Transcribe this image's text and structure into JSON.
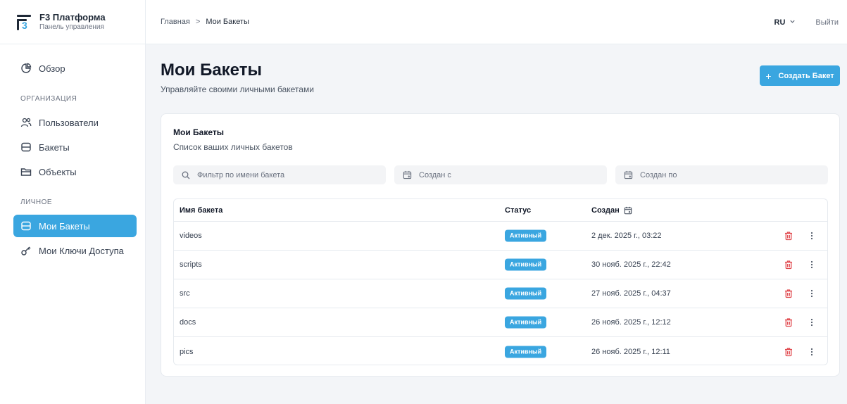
{
  "brand": {
    "title": "F3 Платформа",
    "subtitle": "Панель управления",
    "logo_digit": "3"
  },
  "sidebar": {
    "overview": "Обзор",
    "section_org": "ОРГАНИЗАЦИЯ",
    "users": "Пользователи",
    "buckets": "Бакеты",
    "objects": "Объекты",
    "section_personal": "ЛИЧНОЕ",
    "my_buckets": "Мои Бакеты",
    "my_keys": "Мои Ключи Доступа"
  },
  "topbar": {
    "breadcrumb_home": "Главная",
    "breadcrumb_sep": ">",
    "breadcrumb_current": "Мои Бакеты",
    "lang": "RU",
    "logout": "Выйти"
  },
  "main": {
    "title": "Мои Бакеты",
    "subtitle": "Управляйте своими личными бакетами",
    "create_button": "Создать Бакет",
    "create_plus": "+"
  },
  "card": {
    "title": "Мои Бакеты",
    "subtitle": "Список ваших личных бакетов",
    "filter_name_placeholder": "Фильтр по имени бакета",
    "filter_from_placeholder": "Создан с",
    "filter_to_placeholder": "Создан по"
  },
  "table": {
    "headers": {
      "name": "Имя бакета",
      "status": "Статус",
      "created": "Создан"
    },
    "rows": [
      {
        "name": "videos",
        "status": "Активный",
        "created": "2 дек. 2025 г., 03:22"
      },
      {
        "name": "scripts",
        "status": "Активный",
        "created": "30 нояб. 2025 г., 22:42"
      },
      {
        "name": "src",
        "status": "Активный",
        "created": "27 нояб. 2025 г., 04:37"
      },
      {
        "name": "docs",
        "status": "Активный",
        "created": "26 нояб. 2025 г., 12:12"
      },
      {
        "name": "pics",
        "status": "Активный",
        "created": "26 нояб. 2025 г., 12:11"
      }
    ]
  },
  "icons": {
    "overview": "pie-chart-icon",
    "users": "users-icon",
    "buckets": "database-icon",
    "objects": "folder-icon",
    "my_buckets": "database-icon",
    "my_keys": "key-icon",
    "search": "search-icon",
    "calendar": "calendar-icon",
    "delete": "trash-icon",
    "more": "more-vertical-icon"
  },
  "colors": {
    "accent": "#3aa6e0",
    "danger": "#e0474c",
    "background": "#f3f5f8"
  }
}
